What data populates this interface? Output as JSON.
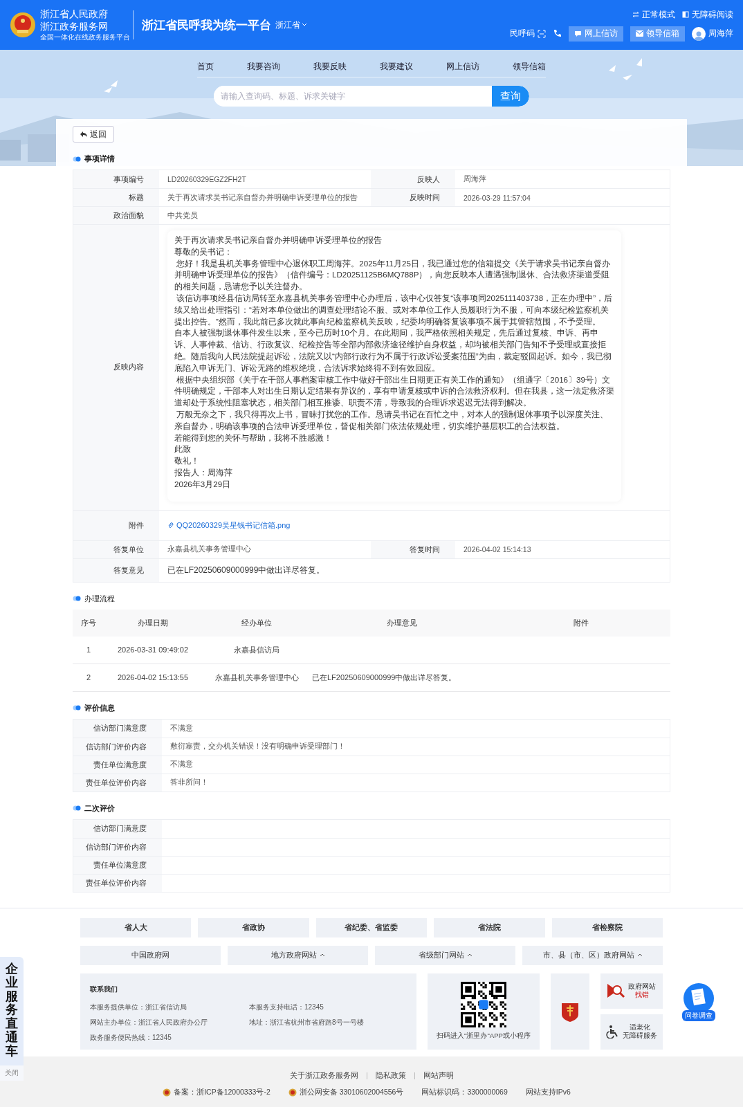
{
  "header": {
    "logo_title": "浙江省人民政府",
    "logo_subtitle": "浙江政务服务网",
    "logo_tagline": "全国一体化在线政务服务平台",
    "platform": "浙江省民呼我为统一平台",
    "region": "浙江省",
    "modes": [
      {
        "label": "正常模式",
        "kind": "mode"
      },
      {
        "label": "无障碍阅读",
        "kind": "access"
      }
    ],
    "code_label": "民呼码",
    "buttons": [
      {
        "label": "网上信访",
        "kind": "petition"
      },
      {
        "label": "领导信箱",
        "kind": "mail"
      }
    ],
    "user": "周海萍"
  },
  "nav": [
    {
      "label": "首页"
    },
    {
      "label": "我要咨询"
    },
    {
      "label": "我要反映"
    },
    {
      "label": "我要建议"
    },
    {
      "label": "网上信访"
    },
    {
      "label": "领导信箱"
    }
  ],
  "search": {
    "placeholder": "请输入查询码、标题、诉求关键字",
    "button": "查询"
  },
  "back_button": "返回",
  "details": {
    "title": "事项详情",
    "rows": [
      {
        "kind": "pair",
        "label": "事项编号",
        "value": "LD20260329EGZ2FH2T",
        "label2": "反映人",
        "value2": "周海萍"
      },
      {
        "kind": "pair",
        "label": "标题",
        "value": "关于再次请求吴书记亲自督办并明确申诉受理单位的报告",
        "label2": "反映时间",
        "value2": "2026-03-29 11:57:04"
      },
      {
        "kind": "single",
        "label": "政治面貌",
        "value": "中共党员"
      },
      {
        "kind": "content",
        "label": "反映内容",
        "paragraphs": [
          "关于再次请求吴书记亲自督办并明确申诉受理单位的报告",
          "尊敬的吴书记：",
          " 您好！我是县机关事务管理中心退休职工周海萍。2025年11月25日，我已通过您的信箱提交《关于请求吴书记亲自督办并明确申诉受理单位的报告》（信件编号：LD20251125B6MQ788P），向您反映本人遭遇强制退休、合法救济渠道受阻的相关问题，恳请您予以关注督办。",
          " 该信访事项经县信访局转至永嘉县机关事务管理中心办理后，该中心仅答复“该事项同2025111403738，正在办理中”，后续又给出处理指引：“若对本单位做出的调查处理结论不服、或对本单位工作人员履职行为不服，可向本级纪检监察机关提出控告。”然而，我此前已多次就此事向纪检监察机关反映，纪委均明确答复该事项不属于其管辖范围，不予受理。",
          "自本人被强制退休事件发生以来，至今已历时10个月。在此期间，我严格依照相关规定，先后通过复核、申诉、再申诉、人事仲裁、信访、行政复议、纪检控告等全部内部救济途径维护自身权益，却均被相关部门告知不予受理或直接拒绝。随后我向人民法院提起诉讼，法院又以“内部行政行为不属于行政诉讼受案范围”为由，裁定驳回起诉。如今，我已彻底陷入申诉无门、诉讼无路的维权绝境，合法诉求始终得不到有效回应。",
          " 根据中央组织部《关于在干部人事档案审核工作中做好干部出生日期更正有关工作的通知》（组通字〔2016〕39号）文件明确规定，干部本人对出生日期认定结果有异议的，享有申请复核或申诉的合法救济权利。但在我县，这一法定救济渠道却处于系统性阻塞状态，相关部门相互推诿、职责不清，导致我的合理诉求迟迟无法得到解决。",
          " 万般无奈之下，我只得再次上书，冒昧打扰您的工作。恳请吴书记在百忙之中，对本人的强制退休事项予以深度关注、亲自督办，明确该事项的合法申诉受理单位，督促相关部门依法依规处理，切实维护基层职工的合法权益。",
          "若能得到您的关怀与帮助，我将不胜感激！",
          "此致",
          "敬礼！",
          "报告人：周海萍",
          "2026年3月29日"
        ]
      },
      {
        "kind": "attachment",
        "label": "附件",
        "value": "QQ20260329吴星钱书记信箱.png"
      },
      {
        "kind": "pair",
        "label": "答复单位",
        "value": "永嘉县机关事务管理中心",
        "label2": "答复时间",
        "value2": "2026-04-02 15:14:13"
      },
      {
        "kind": "reply",
        "label": "答复意见",
        "value": "已在LF20250609000999中做出详尽答复。"
      }
    ]
  },
  "process": {
    "title": "办理流程",
    "columns": [
      "序号",
      "办理日期",
      "经办单位",
      "办理意见",
      "附件"
    ],
    "rows": [
      [
        "1",
        "2026-03-31 09:49:02",
        "永嘉县信访局",
        ""
      ],
      [
        "2",
        "2026-04-02 15:13:55",
        "永嘉县机关事务管理中心",
        "已在LF20250609000999中做出详尽答复。"
      ]
    ]
  },
  "evaluation": {
    "title": "评价信息",
    "rows": [
      {
        "label": "信访部门满意度",
        "value": "不满意"
      },
      {
        "label": "信访部门评价内容",
        "value": "敷衍塞责，交办机关错误！没有明确申诉受理部门！"
      },
      {
        "label": "责任单位满意度",
        "value": "不满意"
      },
      {
        "label": "责任单位评价内容",
        "value": "答非所问！"
      }
    ]
  },
  "second_evaluation": {
    "title": "二次评价",
    "rows": [
      {
        "label": "信访部门满意度"
      },
      {
        "label": "信访部门评价内容"
      },
      {
        "label": "责任单位满意度"
      },
      {
        "label": "责任单位评价内容"
      }
    ]
  },
  "footer": {
    "institutions": [
      "省人大",
      "省政协",
      "省纪委、省监委",
      "省法院",
      "省检察院"
    ],
    "sites": [
      {
        "label": "中国政府网",
        "expandable": false
      },
      {
        "label": "地方政府网站",
        "expandable": true
      },
      {
        "label": "省级部门网站",
        "expandable": true
      },
      {
        "label": "市、县（市、区）政府网站",
        "expandable": true
      }
    ],
    "contact": {
      "title": "联系我们",
      "items": [
        "本服务提供单位：浙江省信访局",
        "本服务支持电话：12345",
        "网站主办单位：浙江省人民政府办公厅",
        "地址：浙江省杭州市省府路8号一号楼",
        "政务服务便民热线：12345"
      ]
    },
    "qr_caption": "扫码进入\"浙里办\"APP或小程序",
    "badges": [
      {
        "kind": "error",
        "title": "政府网站",
        "subtitle": "找错"
      },
      {
        "kind": "elder",
        "title": "适老化",
        "subtitle": "无障碍服务"
      }
    ],
    "links": [
      "关于浙江政务服务网",
      "隐私政策",
      "网站声明"
    ],
    "records": [
      {
        "kind": "emblem",
        "text": "备案：浙ICP备12000333号-2"
      },
      {
        "kind": "emblem",
        "text": "浙公网安备 33010602004556号"
      },
      {
        "kind": "plain",
        "text": "网站标识码：3300000069"
      },
      {
        "kind": "plain",
        "text": "网站支持IPv6"
      }
    ]
  },
  "side_tab": {
    "label": "企业服务直通车",
    "close": "关闭"
  },
  "survey": "问卷调查"
}
